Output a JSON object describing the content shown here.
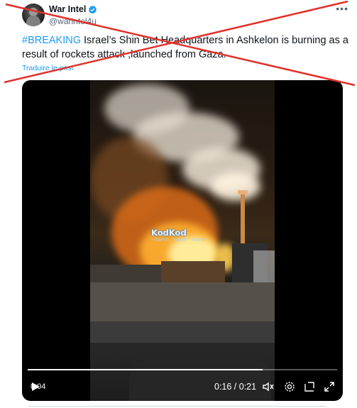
{
  "author": {
    "display_name": "War Intel",
    "handle": "@warintel4u",
    "verified_color": "#1d9bf0"
  },
  "more_icon": "more-horizontal-icon",
  "tweet": {
    "hashtag": "#BREAKING",
    "text": " Israel’s Shin Bet Headquarters in Ashkelon is burning as a result of rockets attack ,launched from Gaza."
  },
  "translate_label": "Traduire le post",
  "video": {
    "watermark": "KodKod",
    "watermark_sub": "חדשות · חדשות · חדשות",
    "elapsed_label": "0:04",
    "time_readout": "0:16 / 0:21",
    "progress_fraction": 0.76,
    "icons": [
      "play-icon",
      "mute-icon",
      "settings-icon",
      "pip-icon",
      "fullscreen-icon"
    ]
  },
  "colors": {
    "accent": "#1d9bf0",
    "cross_mark": "#e0312b",
    "text": "#0f1419",
    "secondary_text": "#536471"
  }
}
